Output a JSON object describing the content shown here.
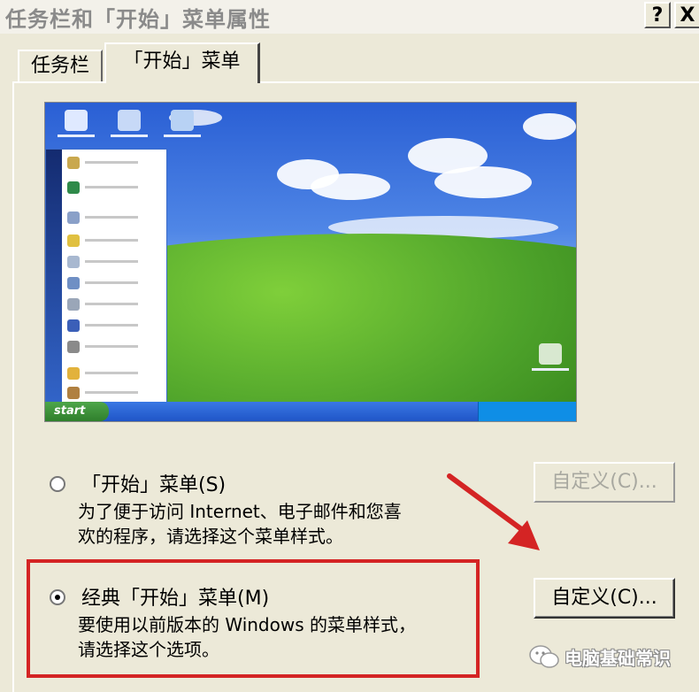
{
  "window": {
    "title": "任务栏和「开始」菜单属性",
    "help_label": "?",
    "close_label": "X"
  },
  "tabs": [
    {
      "label": "任务栏",
      "selected": false
    },
    {
      "label": "「开始」菜单",
      "selected": true
    }
  ],
  "preview": {
    "start_button_label": "start"
  },
  "options": [
    {
      "label": "「开始」菜单(S)",
      "description_lines": [
        "为了便于访问 Internet、电子邮件和您喜",
        "欢的程序，请选择这个菜单样式。"
      ],
      "selected": false,
      "button_label": "自定义(C)...",
      "button_enabled": false
    },
    {
      "label": "经典「开始」菜单(M)",
      "description_lines": [
        "要使用以前版本的 Windows 的菜单样式，",
        "请选择这个选项。"
      ],
      "selected": true,
      "button_label": "自定义(C)...",
      "button_enabled": true
    }
  ],
  "watermark": {
    "text": "电脑基础常识",
    "icon": "wechat-icon"
  },
  "colors": {
    "dialog_bg": "#ece9d8",
    "highlight_box": "#d42424",
    "arrow": "#d42424",
    "disabled_text": "#a8a8a0"
  }
}
